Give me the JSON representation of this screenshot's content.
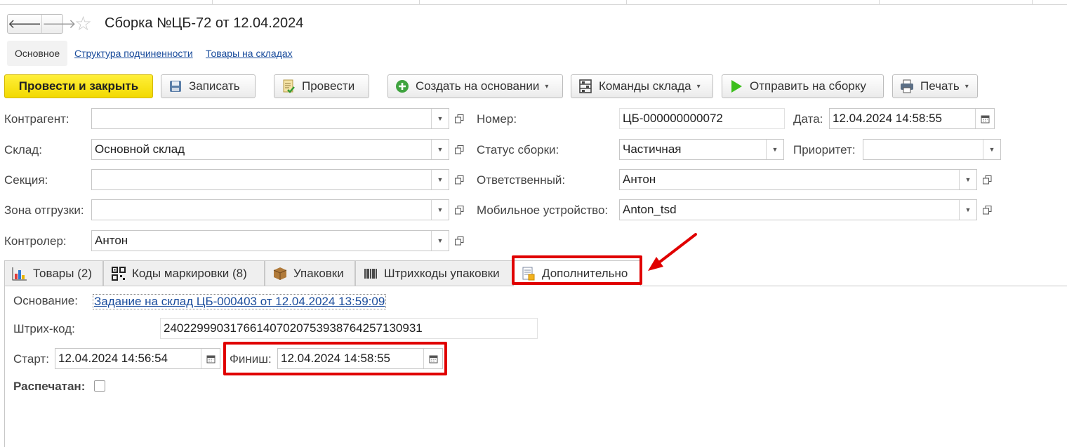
{
  "header": {
    "title": "Сборка №ЦБ-72 от 12.04.2024",
    "back_glyph": "🡐",
    "forward_glyph": "🡒",
    "star_glyph": "☆"
  },
  "subtabs": [
    {
      "label": "Основное"
    },
    {
      "label": "Структура подчиненности"
    },
    {
      "label": "Товары на складах"
    }
  ],
  "toolbar": {
    "post_close": "Провести и закрыть",
    "save": "Записать",
    "post": "Провести",
    "create_based": "Создать на основании",
    "warehouse_cmds": "Команды склада",
    "send_assembly": "Отправить на сборку",
    "print": "Печать",
    "dropdown_glyph": "▾"
  },
  "form": {
    "counterparty": {
      "label": "Контрагент:",
      "value": ""
    },
    "warehouse": {
      "label": "Склад:",
      "value": "Основной склад"
    },
    "section": {
      "label": "Секция:",
      "value": ""
    },
    "shipping_zone": {
      "label": "Зона отгрузки:",
      "value": ""
    },
    "controller": {
      "label": "Контролер:",
      "value": "Антон"
    },
    "number": {
      "label": "Номер:",
      "value": "ЦБ-000000000072"
    },
    "date": {
      "label": "Дата:",
      "value": "12.04.2024 14:58:55"
    },
    "status": {
      "label": "Статус сборки:",
      "value": "Частичная"
    },
    "priority": {
      "label": "Приоритет:",
      "value": ""
    },
    "responsible": {
      "label": "Ответственный:",
      "value": "Антон"
    },
    "mobile_device": {
      "label": "Мобильное устройство:",
      "value": "Anton_tsd"
    }
  },
  "tabs": [
    {
      "label": "Товары (2)"
    },
    {
      "label": "Коды маркировки  (8)"
    },
    {
      "label": "Упаковки"
    },
    {
      "label": "Штрихкоды упаковки"
    },
    {
      "label": "Дополнительно"
    }
  ],
  "extra": {
    "basis_label": "Основание:",
    "basis_value": "Задание на склад ЦБ-000403 от 12.04.2024 13:59:09",
    "barcode_label": "Штрих-код:",
    "barcode_value": "240229990317661407020753938764257130931",
    "start_label": "Старт:",
    "start_value": "12.04.2024 14:56:54",
    "finish_label": "Финиш:",
    "finish_value": "12.04.2024 14:58:55",
    "printed_label": "Распечатан:"
  },
  "colors": {
    "primary_button": "#f5dd00",
    "highlight": "#e00000",
    "link": "#1a4c9c"
  }
}
